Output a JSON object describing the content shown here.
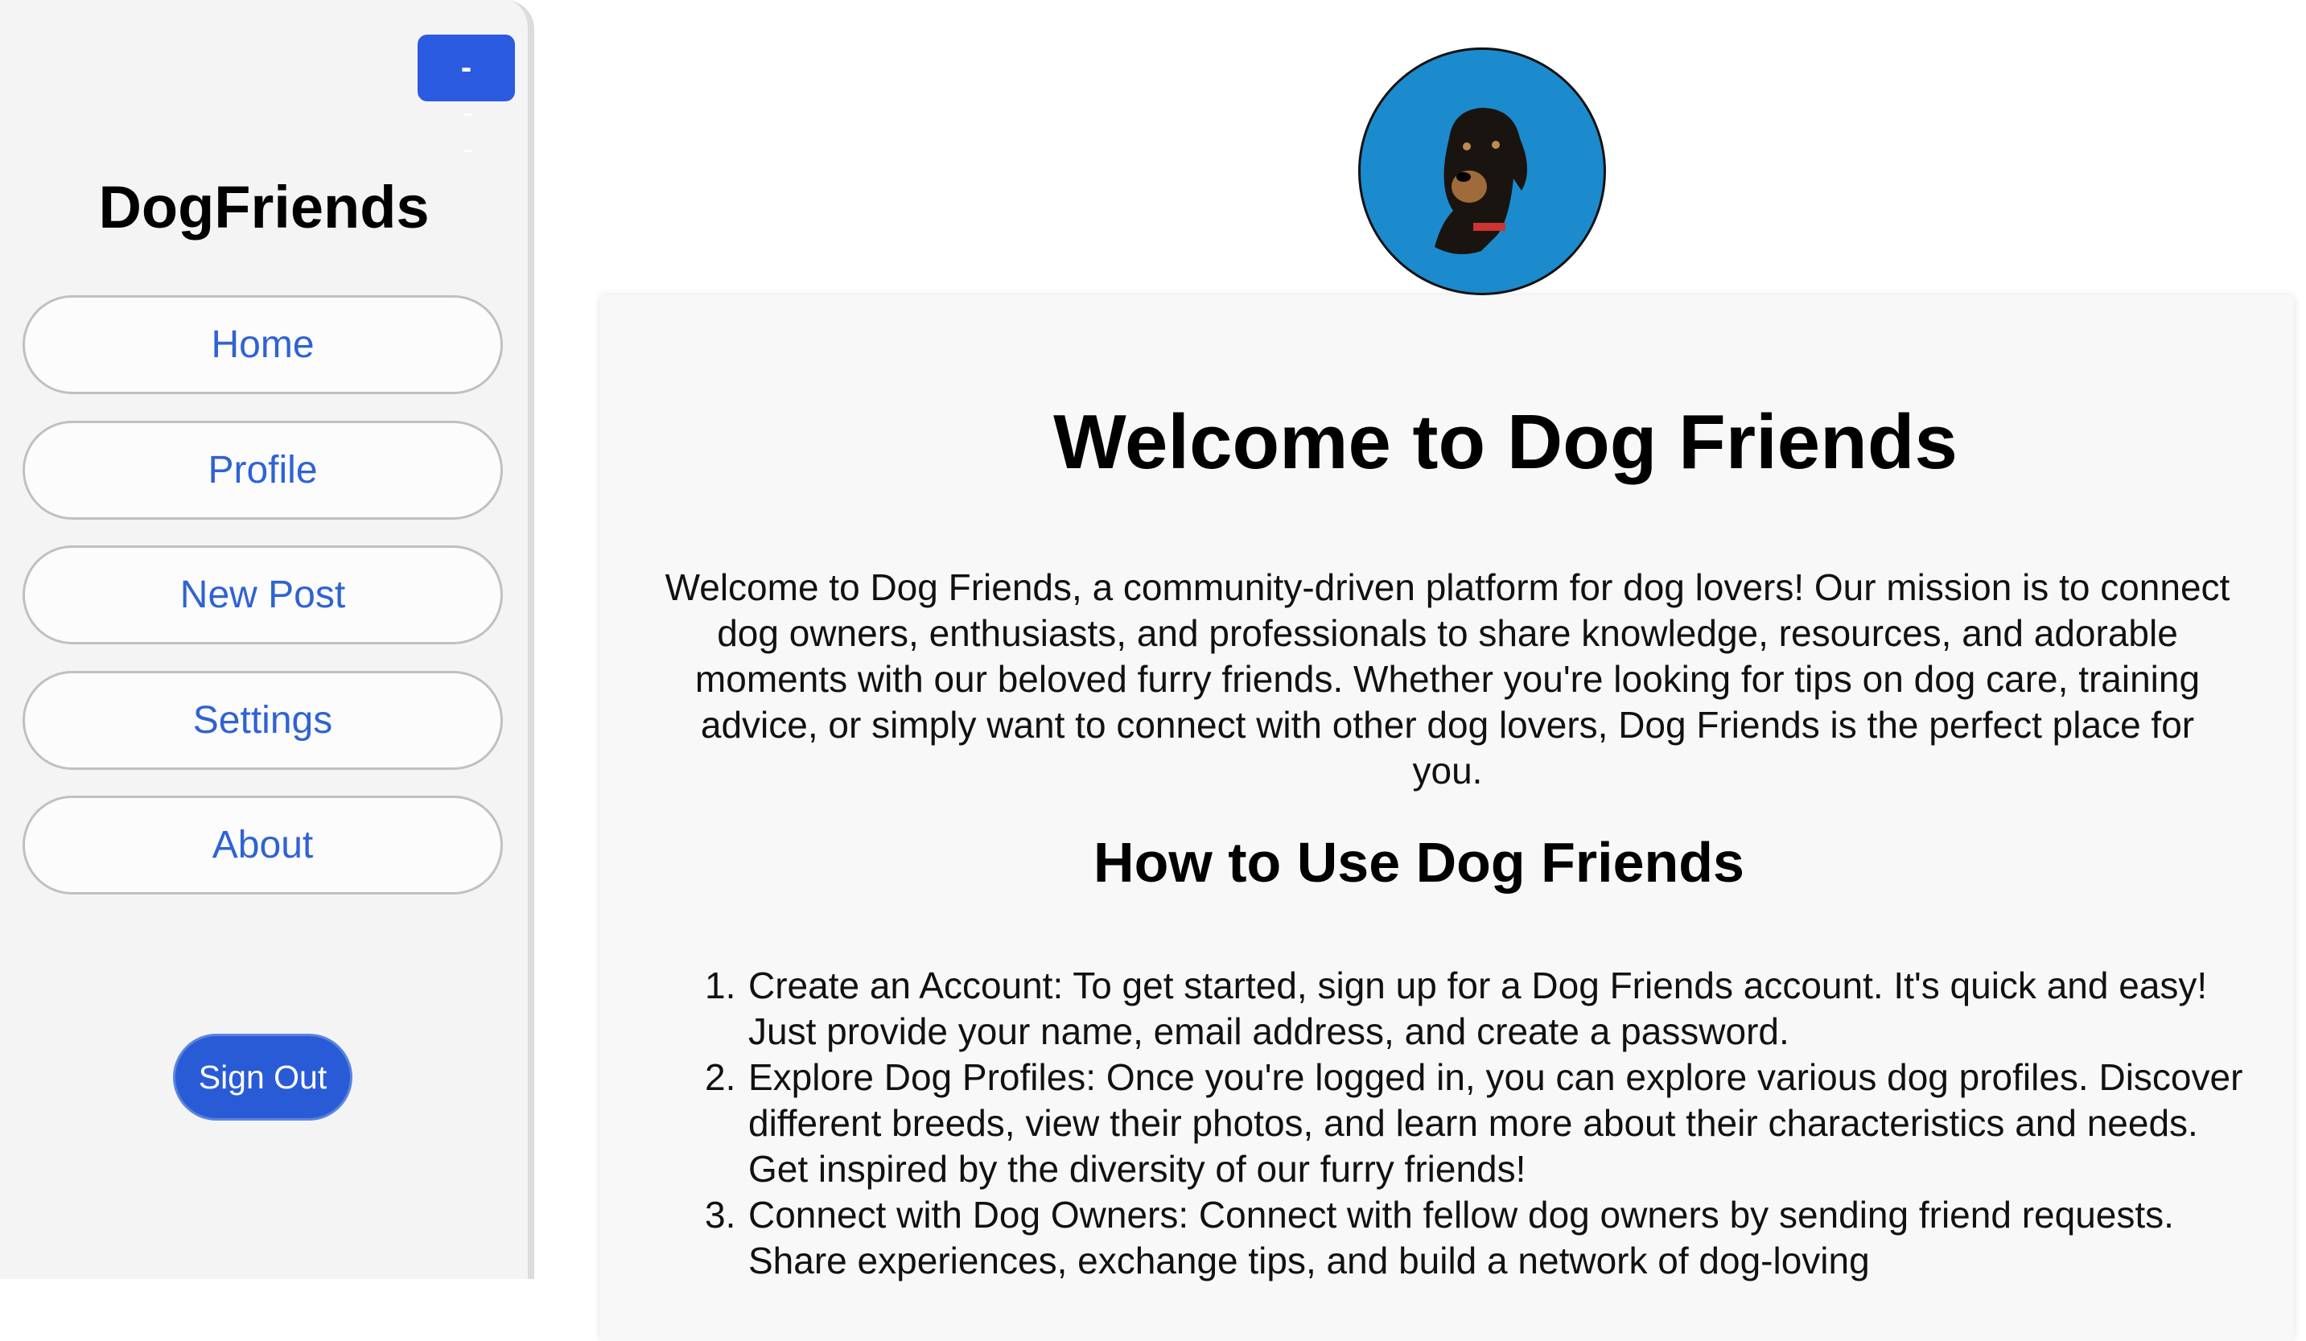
{
  "sidebar": {
    "toggle_label": "-",
    "brand": "DogFriends",
    "nav": [
      {
        "label": "Home"
      },
      {
        "label": "Profile"
      },
      {
        "label": "New Post"
      },
      {
        "label": "Settings"
      },
      {
        "label": "About"
      }
    ],
    "sign_out": "Sign Out"
  },
  "avatar": {
    "icon": "dog-photo"
  },
  "main": {
    "title": "Welcome to Dog Friends",
    "intro": "Welcome to Dog Friends, a community-driven platform for dog lovers! Our mission is to connect dog owners, enthusiasts, and professionals to share knowledge, resources, and adorable moments with our beloved furry friends. Whether you're looking for tips on dog care, training advice, or simply want to connect with other dog lovers, Dog Friends is the perfect place for you.",
    "how_to_title": "How to Use Dog Friends",
    "steps": [
      {
        "num": "1.",
        "text": "Create an Account: To get started, sign up for a Dog Friends account. It's quick and easy! Just provide your name, email address, and create a password."
      },
      {
        "num": "2.",
        "text": "Explore Dog Profiles: Once you're logged in, you can explore various dog profiles. Discover different breeds, view their photos, and learn more about their characteristics and needs. Get inspired by the diversity of our furry friends!"
      },
      {
        "num": "3.",
        "text": "Connect with Dog Owners: Connect with fellow dog owners by sending friend requests. Share experiences, exchange tips, and build a network of dog-loving"
      }
    ]
  },
  "colors": {
    "accent": "#2a5be0",
    "link": "#2f63d3",
    "avatar_bg": "#1b8bcd"
  }
}
